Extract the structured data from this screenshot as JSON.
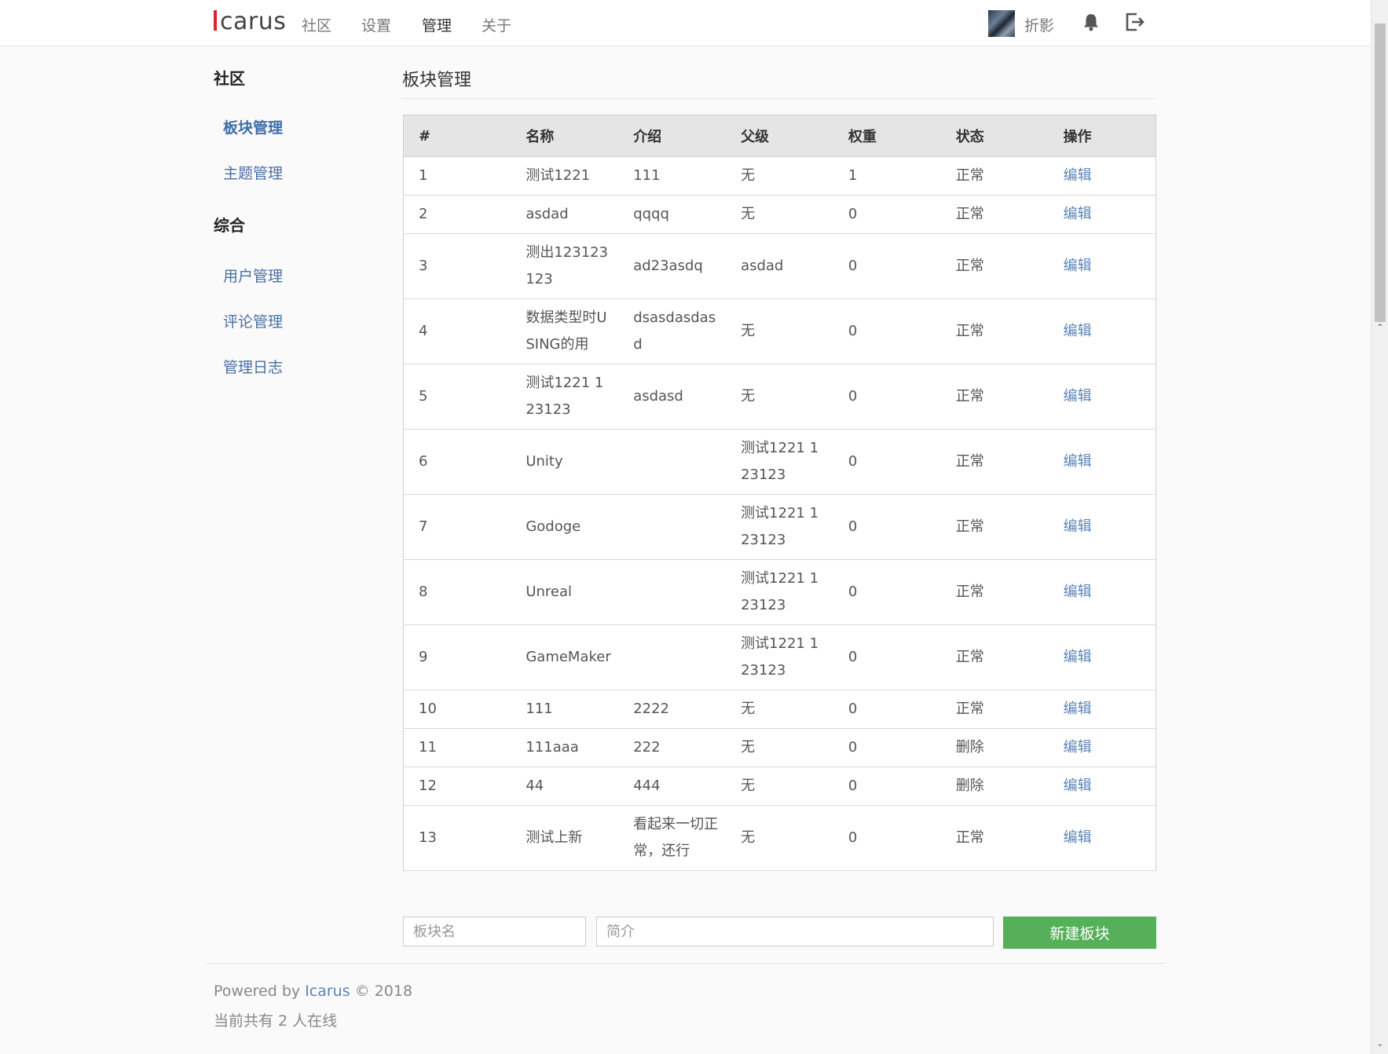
{
  "topbar": {
    "brand": "carus",
    "nav": [
      "社区",
      "设置",
      "管理",
      "关于"
    ],
    "username": "折影"
  },
  "sidebar": {
    "groups": [
      {
        "title": "社区",
        "items": [
          "板块管理",
          "主题管理"
        ]
      },
      {
        "title": "综合",
        "items": [
          "用户管理",
          "评论管理",
          "管理日志"
        ]
      }
    ]
  },
  "main": {
    "title": "板块管理",
    "columns": [
      "#",
      "名称",
      "介绍",
      "父级",
      "权重",
      "状态",
      "操作"
    ],
    "rows": [
      [
        "1",
        "测试1221",
        "111",
        "无",
        "1",
        "正常",
        "编辑"
      ],
      [
        "2",
        "asdad",
        "qqqq",
        "无",
        "0",
        "正常",
        "编辑"
      ],
      [
        "3",
        "测出123123123",
        "ad23asdq",
        "asdad",
        "0",
        "正常",
        "编辑"
      ],
      [
        "4",
        "数据类型时USING的用",
        "dsasdasdasd",
        "无",
        "0",
        "正常",
        "编辑"
      ],
      [
        "5",
        "测试1221 123123",
        "asdasd",
        "无",
        "0",
        "正常",
        "编辑"
      ],
      [
        "6",
        "Unity",
        "",
        "测试1221 123123",
        "0",
        "正常",
        "编辑"
      ],
      [
        "7",
        "Godoge",
        "",
        "测试1221 123123",
        "0",
        "正常",
        "编辑"
      ],
      [
        "8",
        "Unreal",
        "",
        "测试1221 123123",
        "0",
        "正常",
        "编辑"
      ],
      [
        "9",
        "GameMaker",
        "",
        "测试1221 123123",
        "0",
        "正常",
        "编辑"
      ],
      [
        "10",
        "111",
        "2222",
        "无",
        "0",
        "正常",
        "编辑"
      ],
      [
        "11",
        "111aaa",
        "222",
        "无",
        "0",
        "删除",
        "编辑"
      ],
      [
        "12",
        "44",
        "444",
        "无",
        "0",
        "删除",
        "编辑"
      ],
      [
        "13",
        "测试上新",
        "看起来一切正常，还行",
        "无",
        "0",
        "正常",
        "编辑"
      ]
    ],
    "form": {
      "name_placeholder": "板块名",
      "brief_placeholder": "简介",
      "create_label": "新建板块"
    }
  },
  "footer": {
    "powered_prefix": "Powered by ",
    "powered_link": "Icarus",
    "powered_suffix": " © 2018",
    "online": "当前共有 2 人在线"
  }
}
